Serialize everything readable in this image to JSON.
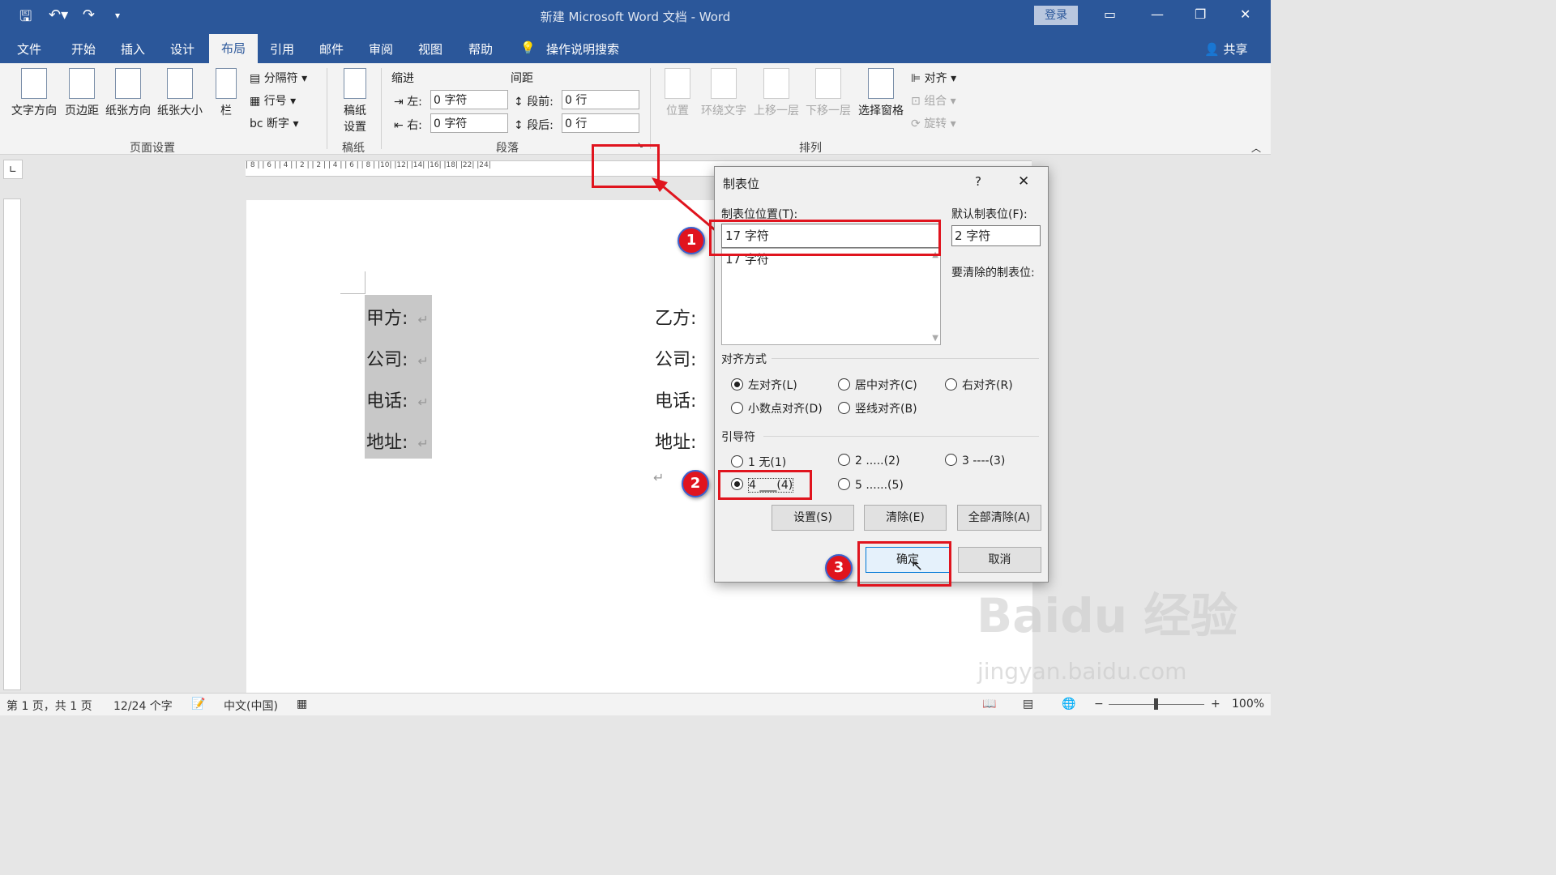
{
  "app": {
    "title": "新建 Microsoft Word 文档  -  Word",
    "login": "登录",
    "share": "共享"
  },
  "tabs": [
    "文件",
    "开始",
    "插入",
    "设计",
    "布局",
    "引用",
    "邮件",
    "审阅",
    "视图",
    "帮助"
  ],
  "active_tab": "布局",
  "search": {
    "label": "操作说明搜索"
  },
  "ribbon": {
    "page_setup": {
      "text_direction": "文字方向",
      "margins": "页边距",
      "orientation": "纸张方向",
      "size": "纸张大小",
      "columns": "栏",
      "breaks": "分隔符",
      "line_numbers": "行号",
      "hyphenation": "断字",
      "group": "页面设置"
    },
    "manuscript": {
      "setup_line1": "稿纸",
      "setup_line2": "设置",
      "group": "稿纸"
    },
    "paragraph": {
      "indent": "缩进",
      "spacing": "间距",
      "left_label": "左:",
      "left_value": "0 字符",
      "right_label": "右:",
      "right_value": "0 字符",
      "before_label": "段前:",
      "before_value": "0 行",
      "after_label": "段后:",
      "after_value": "0 行",
      "group": "段落"
    },
    "arrange": {
      "position": "位置",
      "wrap": "环绕文字",
      "forward": "上移一层",
      "backward": "下移一层",
      "selection_pane": "选择窗格",
      "align": "对齐",
      "group_btn": "组合",
      "rotate": "旋转",
      "group": "排列"
    }
  },
  "ruler_text": "| 8 |   | 6 |   | 4 |   | 2 |       | 2 |   | 4 |   | 6 |   | 8 |  |10|  |12|  |14|  |16|   |18|    |22|  |24|",
  "document": {
    "left_fields": [
      "甲方:",
      "公司:",
      "电话:",
      "地址:"
    ],
    "right_fields": [
      "乙方:",
      "公司:",
      "电话:",
      "地址:"
    ],
    "return_mark": "↵"
  },
  "dialog": {
    "title": "制表位",
    "help": "?",
    "tab_position_label": "制表位位置(T):",
    "tab_position_value": "17 字符",
    "tab_list": [
      "17 字符"
    ],
    "default_label": "默认制表位(F):",
    "default_value": "2 字符",
    "clear_label": "要清除的制表位:",
    "alignment_label": "对齐方式",
    "alignment_options": [
      "左对齐(L)",
      "居中对齐(C)",
      "右对齐(R)",
      "小数点对齐(D)",
      "竖线对齐(B)"
    ],
    "alignment_selected": 0,
    "leader_label": "引导符",
    "leader_options": [
      "1 无(1)",
      "2 .....(2)",
      "3 ----(3)",
      "4 ___(4)",
      "5 ......(5)"
    ],
    "leader_selected": 3,
    "set_button": "设置(S)",
    "clear_button": "清除(E)",
    "clear_all_button": "全部清除(A)",
    "ok_button": "确定",
    "cancel_button": "取消"
  },
  "markers": [
    "1",
    "2",
    "3"
  ],
  "status": {
    "page": "第 1 页，共 1 页",
    "words": "12/24 个字",
    "language": "中文(中国)",
    "zoom": "100%"
  },
  "watermark": {
    "line1": "Baidu 经验",
    "line2": "jingyan.baidu.com"
  },
  "colors": {
    "accent": "#2b579a",
    "highlight": "#e0141e"
  }
}
